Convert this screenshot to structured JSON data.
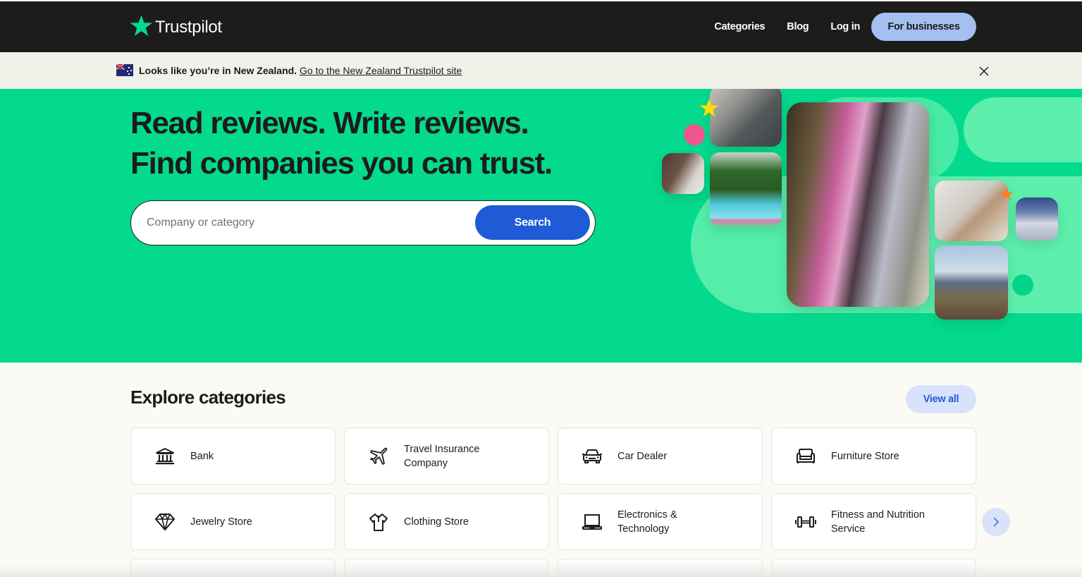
{
  "header": {
    "logo_text": "Trustpilot",
    "nav": {
      "categories": "Categories",
      "blog": "Blog",
      "login": "Log in",
      "for_businesses": "For businesses"
    }
  },
  "banner": {
    "flag": "new-zealand-flag",
    "message": "Looks like you’re in New Zealand.",
    "link_text": "Go to the New Zealand Trustpilot site",
    "close_icon": "close-icon"
  },
  "hero": {
    "title_line1": "Read reviews. Write reviews.",
    "title_line2": "Find companies you can trust.",
    "search": {
      "placeholder": "Company or category",
      "value": "",
      "button_label": "Search"
    }
  },
  "categories": {
    "heading": "Explore categories",
    "view_all_label": "View all",
    "items": [
      {
        "label": "Bank",
        "icon": "bank-icon"
      },
      {
        "label": "Travel Insurance Company",
        "icon": "airplane-icon"
      },
      {
        "label": "Car Dealer",
        "icon": "car-icon"
      },
      {
        "label": "Furniture Store",
        "icon": "armchair-icon"
      },
      {
        "label": "Jewelry Store",
        "icon": "diamond-icon"
      },
      {
        "label": "Clothing Store",
        "icon": "shirt-icon"
      },
      {
        "label": "Electronics & Technology",
        "icon": "laptop-icon"
      },
      {
        "label": "Fitness and Nutrition Service",
        "icon": "dumbbell-icon"
      }
    ],
    "next_icon": "chevron-right-icon"
  },
  "colors": {
    "header_bg": "#1c1c1c",
    "brand_green": "#04da8d",
    "star_green": "#00b67a",
    "banner_bg": "#f1f0e9",
    "search_blue": "#1f5bd6",
    "business_btn": "#a4bff0",
    "view_all_bg": "#d8e3fb",
    "page_bg": "#fbfaf4"
  }
}
